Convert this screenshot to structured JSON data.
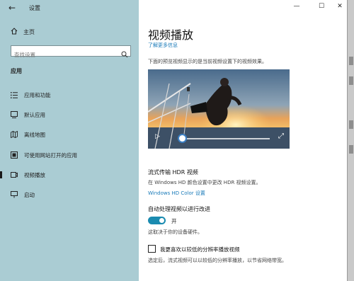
{
  "window": {
    "title": "设置",
    "back_glyph": "←",
    "minimize_glyph": "—",
    "maximize_glyph": "☐",
    "close_glyph": "✕"
  },
  "sidebar": {
    "home_label": "主页",
    "search_placeholder": "查找设置",
    "section_title": "应用",
    "items": [
      {
        "label": "应用和功能",
        "icon": "list-icon"
      },
      {
        "label": "默认应用",
        "icon": "default-apps-icon"
      },
      {
        "label": "离线地图",
        "icon": "map-icon"
      },
      {
        "label": "可使用网站打开的应用",
        "icon": "open-website-icon"
      },
      {
        "label": "视频播放",
        "icon": "video-icon"
      },
      {
        "label": "启动",
        "icon": "startup-icon"
      }
    ]
  },
  "main": {
    "title": "视频播放",
    "learn_more": "了解更多信息",
    "preview_desc": "下面的预览视频显示的是当前视频设置下的视频效果。",
    "video": {
      "play_glyph": "▷",
      "fullscreen_glyph": "⤢",
      "progress": 0.05
    },
    "hdr_heading": "流式传输 HDR 视频",
    "hdr_desc": "在 Windows HD 颜色设置中更改 HDR 视频设置。",
    "hdr_link": "Windows HD Color 设置",
    "auto_heading": "自动处理视频以进行改进",
    "toggle_state": "开",
    "auto_desc": "这取决于你的设备硬件。",
    "checkbox_label": "我更喜欢以较低的分辨率播放视频",
    "checkbox_desc": "选定后，流式视频可以以较低的分辨率播放，以节省网络带宽。"
  },
  "colors": {
    "sidebar_bg": "#aaccd3",
    "accent": "#1a8bb0",
    "link": "#1a7bb9"
  }
}
